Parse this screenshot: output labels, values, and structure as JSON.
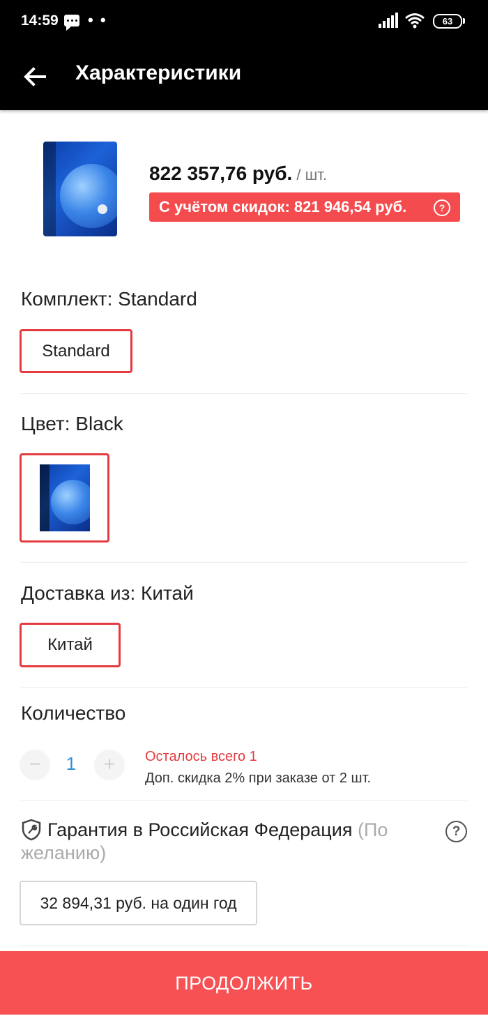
{
  "status_bar": {
    "time": "14:59",
    "notification_dots": "• •",
    "battery": "63"
  },
  "header": {
    "title": "Характеристики",
    "back_icon": "arrow-left-icon"
  },
  "product": {
    "price": "822 357,76 руб.",
    "unit": " / шт.",
    "discount_text": "С учётом скидок: 821 946,54 руб.",
    "help_symbol": "?"
  },
  "kit": {
    "label": "Комплект: Standard",
    "options": [
      "Standard"
    ]
  },
  "color": {
    "label": "Цвет: Black"
  },
  "shipping": {
    "label": "Доставка из: Китай",
    "options": [
      "Китай"
    ]
  },
  "quantity": {
    "label": "Количество",
    "minus": "−",
    "value": "1",
    "plus": "+",
    "stock_left": "Осталось всего 1",
    "promo": "Доп. скидка 2% при заказе от 2 шт."
  },
  "warranty": {
    "title": "Гарантия в Российская Федерация",
    "optional": "(По желанию)",
    "help_symbol": "?",
    "option": "32 894,31 руб. на один год"
  },
  "footer": {
    "continue_label": "ПРОДОЛЖИТЬ"
  },
  "colors": {
    "accent": "#f44b4e",
    "button": "#f85154",
    "selected_border": "#e43b3f",
    "quantity_value": "#2f8fd8"
  }
}
